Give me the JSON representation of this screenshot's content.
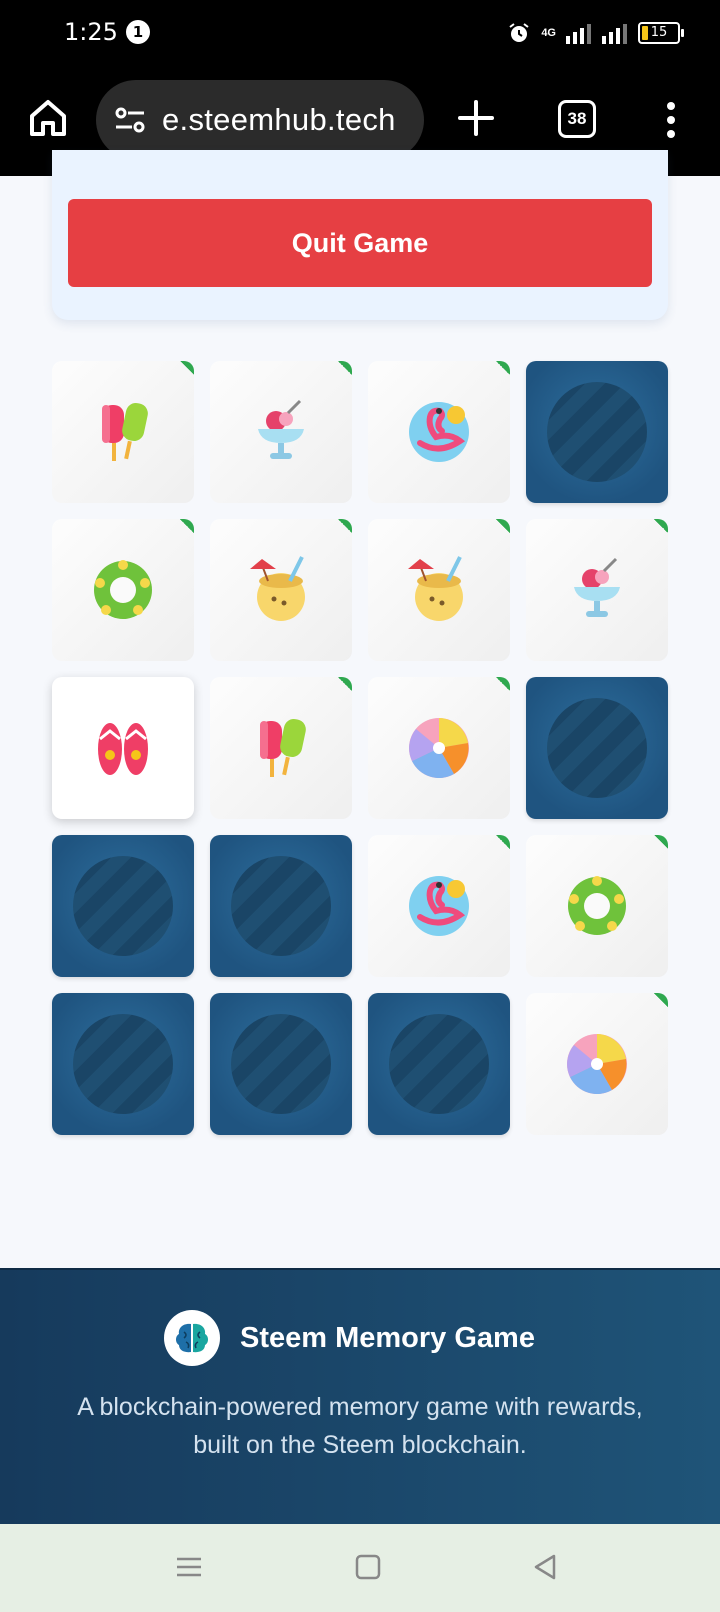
{
  "status_bar": {
    "time": "1:25",
    "notification_count": "1",
    "network": "4G",
    "battery": "15"
  },
  "browser": {
    "url": "e.steemhub.tech",
    "tab_count": "38"
  },
  "game": {
    "quit_label": "Quit Game",
    "cards": [
      {
        "icon": "popsicle",
        "state": "matched"
      },
      {
        "icon": "ice-cream-sundae",
        "state": "matched"
      },
      {
        "icon": "flamingo-float",
        "state": "matched"
      },
      {
        "icon": "card-back",
        "state": "facedown"
      },
      {
        "icon": "swim-ring",
        "state": "matched"
      },
      {
        "icon": "coconut-drink",
        "state": "matched"
      },
      {
        "icon": "coconut-drink",
        "state": "matched"
      },
      {
        "icon": "ice-cream-sundae",
        "state": "matched"
      },
      {
        "icon": "flip-flops",
        "state": "flipped"
      },
      {
        "icon": "popsicle",
        "state": "matched"
      },
      {
        "icon": "beach-ball",
        "state": "matched"
      },
      {
        "icon": "card-back",
        "state": "facedown"
      },
      {
        "icon": "card-back",
        "state": "facedown"
      },
      {
        "icon": "card-back",
        "state": "facedown"
      },
      {
        "icon": "flamingo-float",
        "state": "matched"
      },
      {
        "icon": "swim-ring",
        "state": "matched"
      },
      {
        "icon": "card-back",
        "state": "facedown"
      },
      {
        "icon": "card-back",
        "state": "facedown"
      },
      {
        "icon": "card-back",
        "state": "facedown"
      },
      {
        "icon": "beach-ball",
        "state": "matched"
      }
    ]
  },
  "footer": {
    "brand": "Steem Memory Game",
    "tagline": "A blockchain-powered memory game with rewards, built on the Steem blockchain."
  },
  "colors": {
    "quit_button": "#e63f43",
    "card_back": "#255f8c",
    "match_marker": "#2fa84f",
    "footer_bg": "#1a4567"
  }
}
